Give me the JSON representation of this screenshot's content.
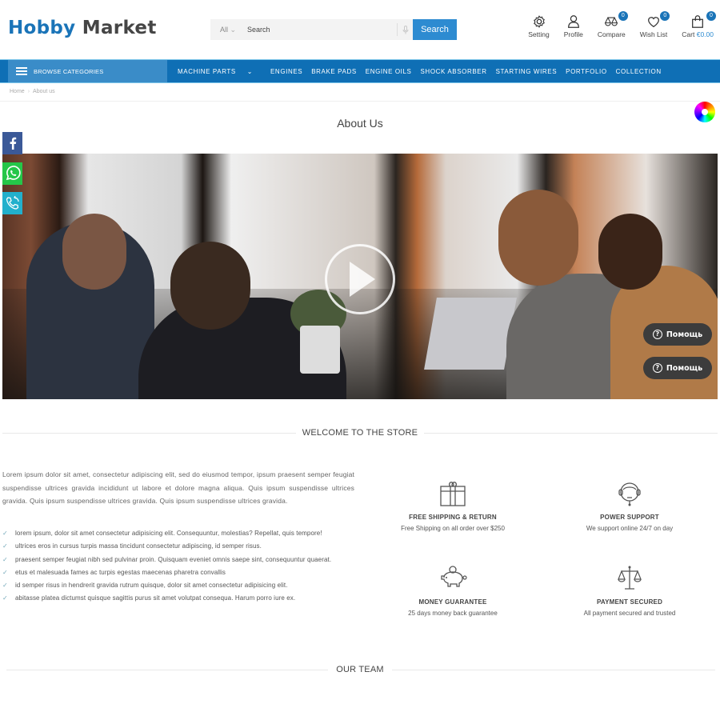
{
  "header": {
    "logo_part1": "Hobby",
    "logo_part2": "Market",
    "search": {
      "category": "All",
      "placeholder": "Search",
      "button_label": "Search"
    },
    "icons": [
      {
        "name": "setting",
        "label": "Setting",
        "icon": "gear-icon"
      },
      {
        "name": "profile",
        "label": "Profile",
        "icon": "user-icon"
      },
      {
        "name": "compare",
        "label": "Compare",
        "icon": "scales-icon",
        "badge": "0"
      },
      {
        "name": "wishlist",
        "label": "Wish List",
        "icon": "heart-icon",
        "badge": "0"
      },
      {
        "name": "cart",
        "label": "Cart",
        "icon": "bag-icon",
        "badge": "0",
        "price": "€0.00"
      }
    ]
  },
  "nav": {
    "browse_label": "BROWSE CATEGORIES",
    "items": [
      "MACHINE PARTS",
      "ENGINES",
      "BRAKE PADS",
      "ENGINE OILS",
      "SHOCK ABSORBER",
      "STARTING WIRES",
      "PORTFOLIO",
      "COLLECTION"
    ]
  },
  "breadcrumb": {
    "home": "Home",
    "current": "About us"
  },
  "page_title": "About Us",
  "help_buttons": [
    "Помощь",
    "Помощь"
  ],
  "welcome": {
    "title": "WELCOME TO THE STORE",
    "intro": "Lorem ipsum dolor sit amet, consectetur adipiscing elit, sed do eiusmod tempor, ipsum praesent semper feugiat suspendisse ultrices gravida incididunt ut labore et dolore magna aliqua. Quis ipsum suspendisse ultrices gravida. Quis ipsum suspendisse ultrices gravida. Quis ipsum suspendisse ultrices gravida.",
    "list": [
      "lorem ipsum, dolor sit amet consectetur adipisicing elit. Consequuntur, molestias? Repellat, quis tempore!",
      "ultrices eros in cursus turpis massa tincidunt consectetur adipiscing, id semper risus.",
      "praesent semper feugiat nibh sed pulvinar proin. Quisquam eveniet omnis saepe sint, consequuntur quaerat.",
      "etus et malesuada fames ac turpis egestas maecenas pharetra convallis",
      "id semper risus in hendrerit gravida rutrum quisque, dolor sit amet consectetur adipisicing elit.",
      "abitasse platea dictumst quisque sagittis purus sit amet volutpat consequa. Harum porro iure ex."
    ]
  },
  "features": [
    {
      "icon": "gift-icon",
      "title": "FREE SHIPPING & RETURN",
      "desc": "Free Shipping on all order over $250"
    },
    {
      "icon": "headset-icon",
      "title": "POWER SUPPORT",
      "desc": "We support online 24/7 on day"
    },
    {
      "icon": "piggy-bank-icon",
      "title": "MONEY GUARANTEE",
      "desc": "25 days money back guarantee"
    },
    {
      "icon": "scales-icon",
      "title": "PAYMENT SECURED",
      "desc": "All payment secured and trusted"
    }
  ],
  "team": {
    "title": "OUR TEAM"
  },
  "colors": {
    "brand": "#1a74b8",
    "nav": "#0f6fb5",
    "accent": "#2d8bd1"
  }
}
